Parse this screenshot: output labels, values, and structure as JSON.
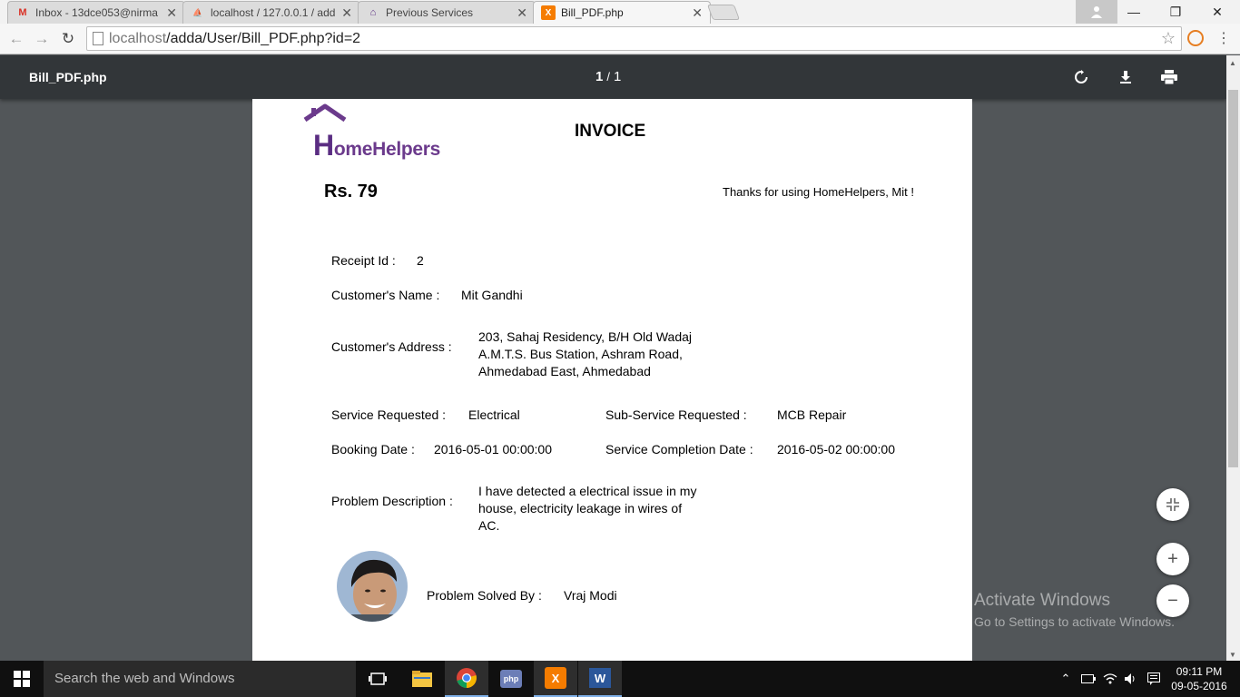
{
  "browser": {
    "tabs": [
      {
        "title": "Inbox - 13dce053@nirma",
        "icon": "gmail-icon",
        "active": false
      },
      {
        "title": "localhost / 127.0.0.1 / add",
        "icon": "phpmyadmin-icon",
        "active": false
      },
      {
        "title": "Previous Services",
        "icon": "homehelpers-icon",
        "active": false
      },
      {
        "title": "Bill_PDF.php",
        "icon": "xampp-icon",
        "active": true
      }
    ],
    "url_host": "localhost",
    "url_path": "/adda/User/Bill_PDF.php?id=2"
  },
  "pdf_viewer": {
    "filename": "Bill_PDF.php",
    "current_page": "1",
    "page_separator": "/",
    "total_pages": "1"
  },
  "invoice": {
    "logo_first": "H",
    "logo_rest": "omeHelpers",
    "heading": "INVOICE",
    "amount": "Rs. 79",
    "thanks": "Thanks for using HomeHelpers, Mit !",
    "receipt_label": "Receipt Id :",
    "receipt_value": "2",
    "name_label": "Customer's Name :",
    "name_value": "Mit Gandhi",
    "address_label": "Customer's Address :",
    "address_lines": [
      "203, Sahaj Residency, B/H Old Wadaj",
      "A.M.T.S. Bus Station, Ashram Road,",
      "Ahmedabad East, Ahmedabad"
    ],
    "service_label": "Service Requested :",
    "service_value": "Electrical",
    "subservice_label": "Sub-Service Requested :",
    "subservice_value": "MCB Repair",
    "booking_label": "Booking Date :",
    "booking_value": "2016-05-01 00:00:00",
    "completion_label": "Service Completion Date :",
    "completion_value": "2016-05-02 00:00:00",
    "problem_label": "Problem Description :",
    "problem_lines": [
      "I have detected a electrical issue in my",
      "house, electricity leakage in wires of",
      "AC."
    ],
    "solved_label": "Problem Solved By :",
    "solved_value": "Vraj Modi"
  },
  "watermark": {
    "line1": "Activate Windows",
    "line2": "Go to Settings to activate Windows."
  },
  "taskbar": {
    "search_placeholder": "Search the web and Windows",
    "time": "09:11 PM",
    "date": "09-05-2016"
  },
  "colors": {
    "brand_purple": "#6b3a8c",
    "pdf_toolbar": "#323639",
    "viewer_bg": "#525659"
  }
}
